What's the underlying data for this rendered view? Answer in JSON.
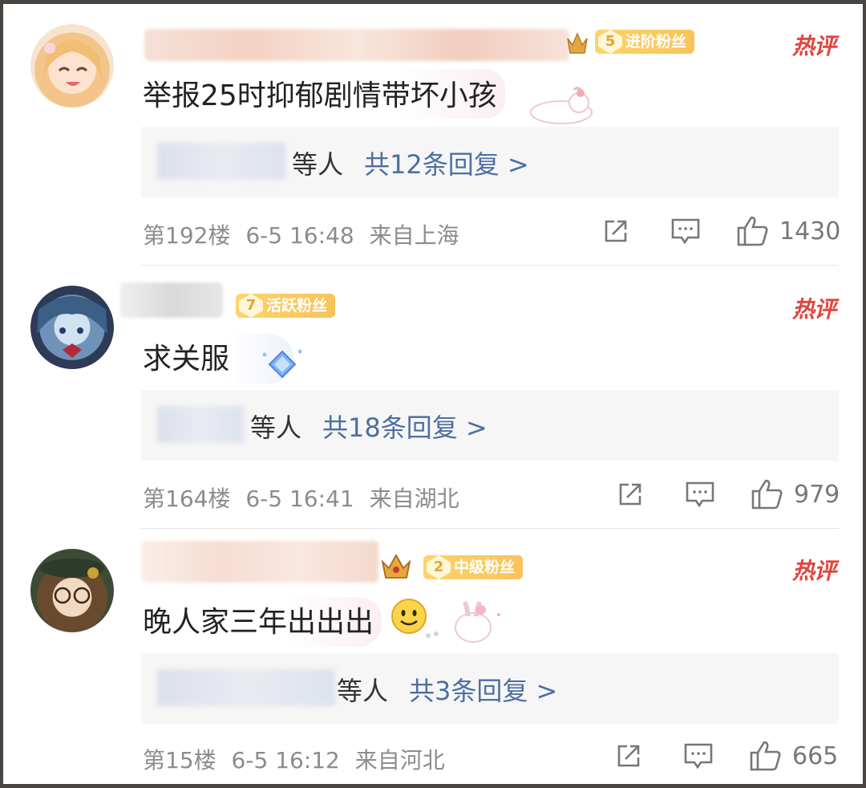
{
  "comments": [
    {
      "text": "举报25时抑郁剧情带坏小孩",
      "fan_level": "5",
      "fan_label": "进阶粉丝",
      "hot_label": "热评",
      "reply_etc": "等人",
      "reply_link": "共12条回复 >",
      "floor": "第192楼",
      "time": "6-5 16:48",
      "location": "来自上海",
      "likes": "1430"
    },
    {
      "text": "求关服",
      "fan_level": "7",
      "fan_label": "活跃粉丝",
      "hot_label": "热评",
      "reply_etc": "等人",
      "reply_link": "共18条回复 >",
      "floor": "第164楼",
      "time": "6-5 16:41",
      "location": "来自湖北",
      "likes": "979"
    },
    {
      "text": "晚人家三年出出出",
      "fan_level": "2",
      "fan_label": "中级粉丝",
      "hot_label": "热评",
      "reply_etc": "等人",
      "reply_link": "共3条回复 >",
      "floor": "第15楼",
      "time": "6-5 16:12",
      "location": "来自河北",
      "likes": "665"
    }
  ],
  "icons": {
    "share": "share-icon",
    "comment": "comment-icon",
    "like": "thumbs-up-icon",
    "smile": "smile-emoji-icon",
    "crown": "crown-icon"
  },
  "colors": {
    "hot": "#e1453f",
    "link": "#4d6fa0",
    "meta": "#8c8c8c",
    "badge": "#f8c35a"
  }
}
